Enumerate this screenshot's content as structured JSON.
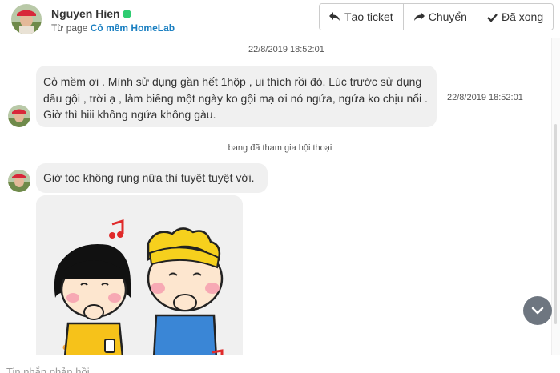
{
  "header": {
    "contact_name": "Nguyen Hien",
    "status": "online",
    "page_prefix": "Từ page",
    "page_name": "Cỏ mềm HomeLab",
    "buttons": {
      "create_ticket": "Tạo ticket",
      "transfer": "Chuyển",
      "done": "Đã xong"
    }
  },
  "conversation": {
    "date_separator": "22/8/2019 18:52:01",
    "messages": [
      {
        "text": "Cỏ mềm ơi . Mình sử dụng gần hết 1hộp , ui thích rồi đó. Lúc trước sử dụng dầu gội , trời ạ , làm biếng một ngày ko gội mạ ơi nó ngứa, ngứa ko chịu nổi . Giờ thì hiii không ngứa không gàu.",
        "time": "22/8/2019 18:52:01"
      },
      {
        "text": "Giờ tóc không rụng nữa thì tuyệt tuyệt vời."
      }
    ],
    "system_message": "bang đã tham gia hội thoại"
  },
  "composer": {
    "placeholder": "Tin nhắn phản hồi"
  },
  "colors": {
    "online": "#2ecc71",
    "link": "#1a7fc1",
    "bubble": "#f0f0f0",
    "scroll_button": "#6e7680"
  },
  "icons": [
    "reply-icon",
    "share-icon",
    "check-icon",
    "chevron-down-icon"
  ]
}
